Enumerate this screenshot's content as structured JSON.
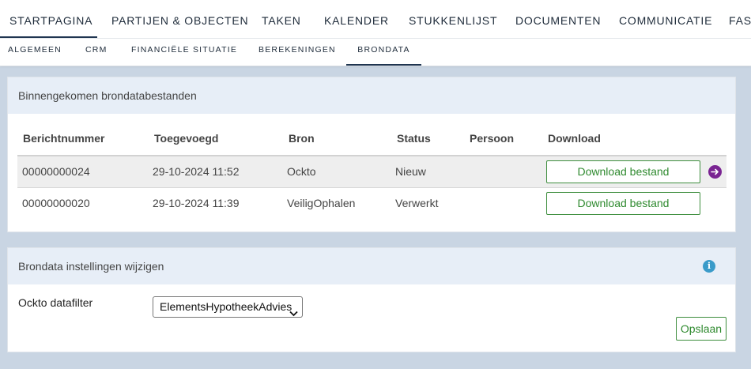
{
  "topnav": {
    "tabs": [
      {
        "label": "STARTPAGINA",
        "active": true
      },
      {
        "label": "PARTIJEN & OBJECTEN"
      },
      {
        "label": "TAKEN"
      },
      {
        "label": "KALENDER"
      },
      {
        "label": "STUKKENLIJST"
      },
      {
        "label": "DOCUMENTEN"
      },
      {
        "label": "COMMUNICATIE"
      },
      {
        "label": "FAST"
      }
    ]
  },
  "subnav": {
    "tabs": [
      {
        "label": "ALGEMEEN"
      },
      {
        "label": "CRM"
      },
      {
        "label": "FINANCIËLE SITUATIE"
      },
      {
        "label": "BEREKENINGEN"
      },
      {
        "label": "BRONDATA",
        "active": true
      }
    ]
  },
  "incoming": {
    "title": "Binnengekomen brondatabestanden",
    "columns": [
      "Berichtnummer",
      "Toegevoegd",
      "Bron",
      "Status",
      "Persoon",
      "Download"
    ],
    "rows": [
      {
        "nummer": "00000000024",
        "toegevoegd": "29-10-2024 11:52",
        "bron": "Ockto",
        "status": "Nieuw",
        "persoon": "",
        "download_label": "Download bestand"
      },
      {
        "nummer": "00000000020",
        "toegevoegd": "29-10-2024 11:39",
        "bron": "VeiligOphalen",
        "status": "Verwerkt",
        "persoon": "",
        "download_label": "Download bestand"
      }
    ]
  },
  "settings": {
    "title": "Brondata instellingen wijzigen",
    "filter_label": "Ockto datafilter",
    "filter_value": "ElementsHypotheekAdvies",
    "save_label": "Opslaan",
    "info_glyph": "i"
  },
  "colors": {
    "accent_green": "#2f8a2f",
    "nav_dark": "#1f3550",
    "purple_arrow": "#7a2492",
    "info_blue": "#3a9bc9",
    "page_bg": "#c9d5e3",
    "panel_head_bg": "#e7eef7"
  },
  "icons": {
    "row_action": "arrow-right-circle-icon",
    "info": "info-icon",
    "select": "chevron-down-icon"
  }
}
